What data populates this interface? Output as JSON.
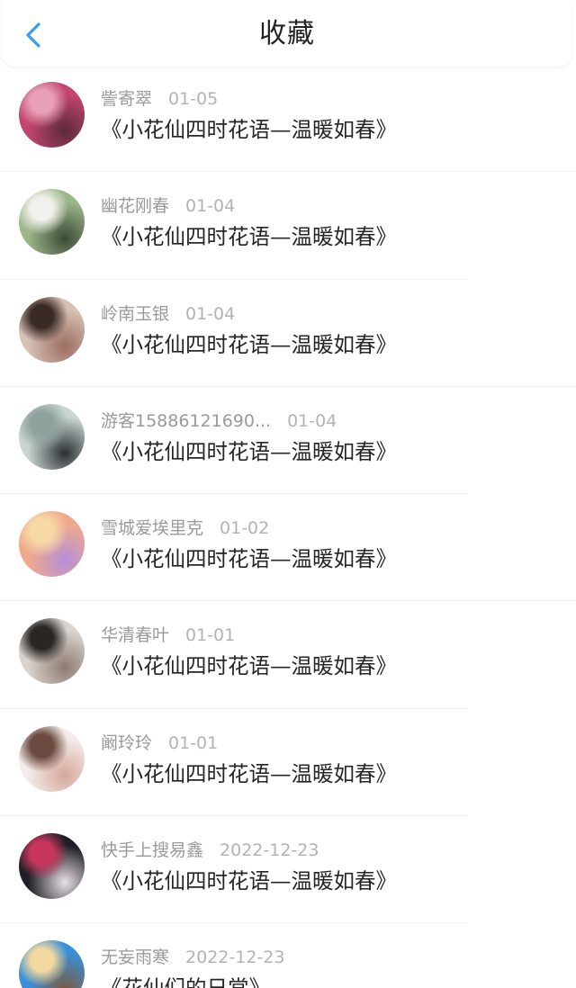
{
  "header": {
    "title": "收藏",
    "back_icon": "chevron-left-icon",
    "accent_color": "#3a9cf2"
  },
  "items": [
    {
      "name": "訾寄翠",
      "date": "01-05",
      "title": "《小花仙四时花语—温暖如春》",
      "avatar_colors": [
        "#c2456f",
        "#e8a0b6",
        "#5a2a3c"
      ]
    },
    {
      "name": "幽花刚春",
      "date": "01-04",
      "title": "《小花仙四时花语—温暖如春》",
      "avatar_colors": [
        "#9cb88a",
        "#f2f0ec",
        "#3d4a36"
      ]
    },
    {
      "name": "岭南玉银",
      "date": "01-04",
      "title": "《小花仙四时花语—温暖如春》",
      "avatar_colors": [
        "#d8c0b4",
        "#3a2a26",
        "#9b6e62"
      ]
    },
    {
      "name": "游客15886121690...",
      "date": "01-04",
      "title": "《小花仙四时花语—温暖如春》",
      "avatar_colors": [
        "#c9d6d2",
        "#8fa39e",
        "#2b2f33"
      ]
    },
    {
      "name": "雪城爱埃里克",
      "date": "01-02",
      "title": "《小花仙四时花语—温暖如春》",
      "avatar_colors": [
        "#f1a98c",
        "#f7d9a6",
        "#b58fd8"
      ]
    },
    {
      "name": "华清春叶",
      "date": "01-01",
      "title": "《小花仙四时花语—温暖如春》",
      "avatar_colors": [
        "#d9d4cf",
        "#2a2624",
        "#8d7b72"
      ]
    },
    {
      "name": "阚玲玲",
      "date": "01-01",
      "title": "《小花仙四时花语—温暖如春》",
      "avatar_colors": [
        "#f3ece9",
        "#6b4a40",
        "#d6a89b"
      ]
    },
    {
      "name": "快手上搜易鑫",
      "date": "2022-12-23",
      "title": "《小花仙四时花语—温暖如春》",
      "avatar_colors": [
        "#1e1e24",
        "#c7365f",
        "#e8e0e6"
      ]
    },
    {
      "name": "无妄雨寒",
      "date": "2022-12-23",
      "title": "《花仙们的日常》",
      "avatar_colors": [
        "#3b8fd6",
        "#f2d9a0",
        "#7a5a3c"
      ]
    }
  ]
}
